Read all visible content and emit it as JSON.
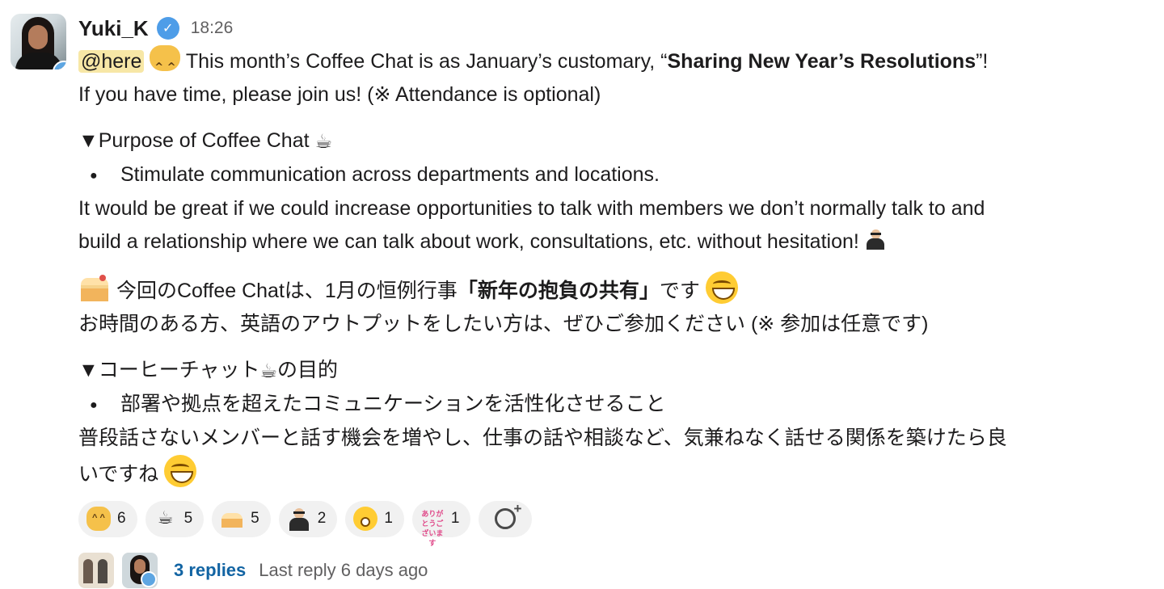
{
  "author": {
    "name": "Yuki_K",
    "time": "18:26"
  },
  "message": {
    "mention": "@here",
    "line1_prefix": " This month’s Coffee Chat is as January’s customary, “",
    "line1_bold": "Sharing New Year’s Resolutions",
    "line1_suffix": "”!",
    "line2": "If you have time, please join us! (※ Attendance is optional)",
    "purpose_heading": "▼Purpose of Coffee Chat ",
    "bullet_en": "Stimulate communication across departments and locations.",
    "para_en_1": "It would be great if we could increase opportunities to talk with members we don’t normally talk to and",
    "para_en_2": "build a relationship where we can talk about work, consultations, etc. without hesitation! ",
    "jp_line1_prefix": " 今回のCoffee Chatは、1月の恒例行事",
    "jp_line1_bold": "「新年の抱負の共有」",
    "jp_line1_suffix": "です ",
    "jp_line2": "お時間のある方、英語のアウトプットをしたい方は、ぜひご参加ください (※ 参加は任意です)",
    "jp_heading_prefix": "▼コーヒーチャット",
    "jp_heading_suffix": "の目的",
    "bullet_jp": "部署や拠点を超えたコミュニケーションを活性化させること",
    "jp_para_1": "普段話さないメンバーと話す機会を増やし、仕事の話や相談など、気兼ねなく話せる関係を築けたら良",
    "jp_para_2": "いですね "
  },
  "icons": {
    "cat": "smiley-cat-icon",
    "coffee": "☕",
    "cake": "cake-icon",
    "grin": "grinning-face-icon",
    "man": "man-office-icon"
  },
  "reactions": [
    {
      "icon": "cat-icon",
      "count": "6"
    },
    {
      "icon": "coffee-icon",
      "count": "5"
    },
    {
      "icon": "cake-icon",
      "count": "5"
    },
    {
      "icon": "man-icon",
      "count": "2"
    },
    {
      "icon": "scream-icon",
      "count": "1"
    },
    {
      "icon": "thanks-icon",
      "count": "1",
      "label": "ありがとうございます"
    }
  ],
  "thread": {
    "replies": "3 replies",
    "last_reply": "Last reply 6 days ago"
  },
  "colors": {
    "link": "#1264a3",
    "mention_bg": "#f7e7a6",
    "verified": "#4e9de8"
  }
}
